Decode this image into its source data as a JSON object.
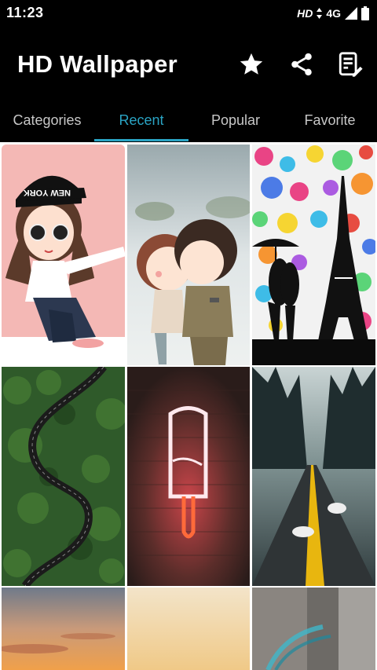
{
  "status_bar": {
    "time": "11:23",
    "network_hd": "HD",
    "network_type": "4G"
  },
  "app_bar": {
    "title": "HD Wallpaper",
    "icons": [
      "star-icon",
      "share-icon",
      "edit-note-icon"
    ]
  },
  "tabs": [
    {
      "label": "Categories",
      "active": false
    },
    {
      "label": "Recent",
      "active": true
    },
    {
      "label": "Popular",
      "active": false
    },
    {
      "label": "Favorite",
      "active": false
    }
  ],
  "wallpapers": [
    {
      "subject": "cartoon girl in New York cap",
      "cap_text": "NEW YORK"
    },
    {
      "subject": "cartoon couple kissing"
    },
    {
      "subject": "couple under umbrella with Eiffel tower and paint splashes"
    },
    {
      "subject": "aerial winding road through forest"
    },
    {
      "subject": "neon popsicle on brick wall"
    },
    {
      "subject": "road through misty pine forest with sneakers"
    },
    {
      "subject": "sunset sky"
    },
    {
      "subject": "soft peach gradient"
    },
    {
      "subject": "blurred guitar strings"
    }
  ],
  "colors": {
    "accent": "#2aa4c4",
    "tab_inactive": "#c7c7c7",
    "background": "#000000"
  }
}
